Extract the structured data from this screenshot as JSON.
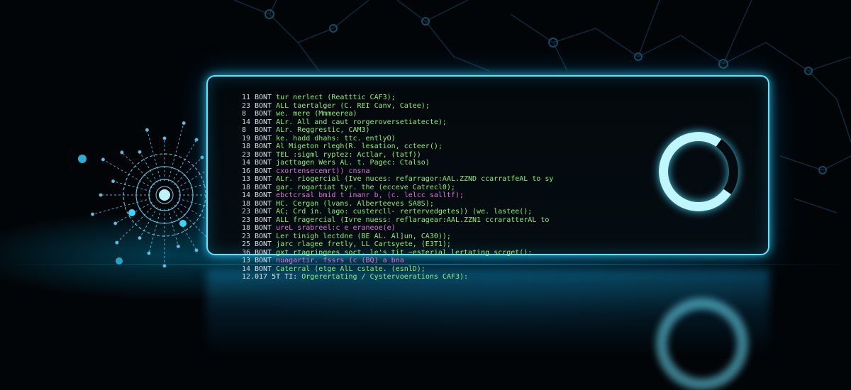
{
  "code_panel": {
    "lines": [
      {
        "num": "11",
        "kw": "BONT",
        "text": "tur nerlect (Reatttic CAF3);",
        "color": "green"
      },
      {
        "num": "23",
        "kw": "BONT",
        "text": "ALL taertalger (C. REI Canv, Catee);",
        "color": "green"
      },
      {
        "num": "8",
        "kw": "BONT",
        "text": "we. mere (Mmmeerea)",
        "color": "green"
      },
      {
        "num": "14",
        "kw": "BONT",
        "text": "ALr. All and caut rorgeroversetiatecte);",
        "color": "green"
      },
      {
        "num": "8",
        "kw": "BONT",
        "text": "ALr. Reggrestic, CAM3)",
        "color": "green"
      },
      {
        "num": "19",
        "kw": "BONT",
        "text": "ke. hadd dhahs: ttc. entlyO)",
        "color": "green"
      },
      {
        "num": "18",
        "kw": "BONT",
        "text": "Al Migeton rlegh(R. lesation, ccteer();",
        "color": "green"
      },
      {
        "num": "23",
        "kw": "BONT",
        "text": "TEL :sigml ryptez: Actlar, (tatf))",
        "color": "green"
      },
      {
        "num": "14",
        "kw": "BONT",
        "text": "jacttagen Wers AL. t. Pagec: Ctalso)",
        "color": "green"
      },
      {
        "num": "16",
        "kw": "BONT",
        "text": "cxortensecemrt)) cnsna",
        "color": "pink"
      },
      {
        "num": "13",
        "kw": "BONT",
        "text": "ALr. riogercial (Ive nuces: refarragor:AAL.ZZND ccarratfeAL to sytsert);",
        "color": "green"
      },
      {
        "num": "18",
        "kw": "BONT",
        "text": "gar. rogartiat tyr. the (ecceve Catrecl0);",
        "color": "green"
      },
      {
        "num": "14",
        "kw": "BONT",
        "text": "ebctcrsal bmid t inanr b, (c. lelcc salltf);",
        "color": "pink"
      },
      {
        "num": "18",
        "kw": "BONT",
        "text": "HC. Cergan (lvans. Alberteeves SA8S);",
        "color": "green"
      },
      {
        "num": "23",
        "kw": "BONT",
        "text": "AC; Crd in. lago: custercll- rertervedgetes)) (we. lastee();",
        "color": "green"
      },
      {
        "num": "23",
        "kw": "BONT",
        "text": "ALL fragercial (Ivre nuess: reflaragear:AAL.ZZN1 ccraratterAL to sytocal);",
        "color": "green"
      },
      {
        "num": "18",
        "kw": "BONT",
        "text": "ureL srabreel:c e eraneoe(e)",
        "color": "pink"
      },
      {
        "num": "23",
        "kw": "BONT",
        "text": "Ler tinigh lectdne (BE AL. Al]un, CA30));",
        "color": "green"
      },
      {
        "num": "25",
        "kw": "BONT",
        "text": "jarc rlagee fretly, LL Cartsyete, (E3T1);",
        "color": "green"
      },
      {
        "num": "36",
        "kw": "BONT",
        "text": "gxt rtagringees soct. le's tit ~esterial lertating scrget();",
        "color": "green"
      },
      {
        "num": "13",
        "kw": "BONT",
        "text": "nuagartir. fssrs (c (BQ) a bna",
        "color": "pink"
      },
      {
        "num": "14",
        "kw": "BONT",
        "text": "Caterral (etge AlL cstate. (esnlD);",
        "color": "green"
      },
      {
        "num": "12.",
        "kw": "017 5T TI:",
        "text": "Orgerertating / Cystervoerations CAF3):",
        "color": "green"
      }
    ]
  },
  "colors": {
    "accent_cyan": "#5fe6ff",
    "code_green": "#8cf07a",
    "code_pink": "#e06fd6",
    "background": "#020508"
  },
  "icons": {
    "ring": "power-ring-icon",
    "network": "neural-network-icon"
  }
}
